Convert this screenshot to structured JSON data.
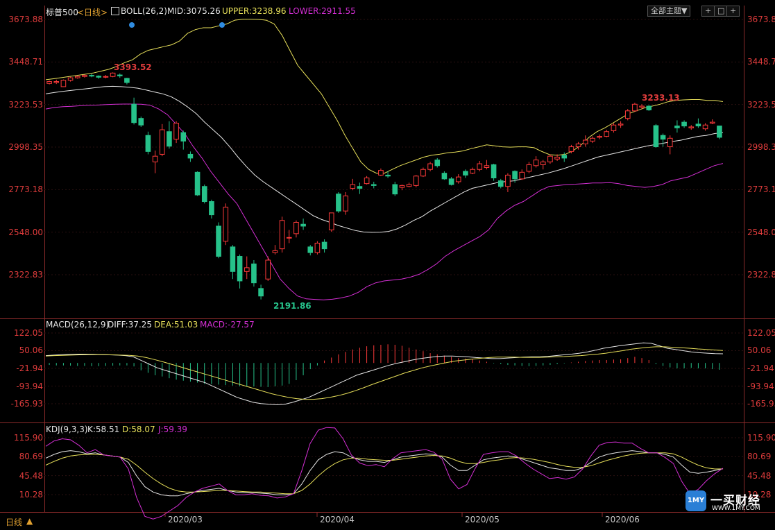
{
  "header": {
    "symbol": "标普500",
    "period_tag": "<日线>",
    "boll": {
      "label": "BOLL(26,2)",
      "mid": "MID:3075.26",
      "upper": "UPPER:3238.96",
      "lower": "LOWER:2911.55"
    },
    "theme_button": "全部主题▼",
    "tool_icons": [
      "+",
      "□",
      "+"
    ]
  },
  "macd_header": {
    "label": "MACD(26,12,9)",
    "diff": "DIFF:37.25",
    "dea": "DEA:51.03",
    "macd": "MACD:-27.57"
  },
  "kdj_header": {
    "label": "KDJ(9,3,3)",
    "k": "K:58.51",
    "d": "D:58.07",
    "j": "J:59.39"
  },
  "price_axis": [
    "3673.88",
    "3448.71",
    "3223.53",
    "2998.35",
    "2773.18",
    "2548.00",
    "2322.83"
  ],
  "macd_axis": [
    "122.05",
    "50.06",
    "-21.94",
    "-93.94",
    "-165.93"
  ],
  "kdj_axis": [
    "115.90",
    "80.69",
    "45.48",
    "10.28"
  ],
  "x_axis": [
    "2020/03",
    "2020/04",
    "2020/05",
    "2020/06"
  ],
  "annotations": {
    "high_left": "3393.52",
    "low": "2191.86",
    "high_right": "3233.13"
  },
  "footer": {
    "period": "日线",
    "arrow": "▲"
  },
  "watermark": {
    "brand": "一买财经",
    "url": "WWW.1MY.COM",
    "logo_text": "1MY"
  },
  "colors": {
    "up": "#ff3b3b",
    "down": "#26c28a",
    "upper": "#e8e05a",
    "mid": "#e6e6e6",
    "lower": "#d52fd5",
    "label_red": "#e03c3c"
  },
  "chart_data": {
    "type": "candlestick",
    "candles": [
      {
        "o": 3335,
        "c": 3345,
        "h": 3350,
        "l": 3330
      },
      {
        "o": 3340,
        "c": 3345,
        "h": 3355,
        "l": 3332
      },
      {
        "o": 3318,
        "c": 3352,
        "h": 3356,
        "l": 3316
      },
      {
        "o": 3352,
        "c": 3365,
        "h": 3370,
        "l": 3345
      },
      {
        "o": 3365,
        "c": 3372,
        "h": 3376,
        "l": 3360
      },
      {
        "o": 3372,
        "c": 3378,
        "h": 3382,
        "l": 3366
      },
      {
        "o": 3378,
        "c": 3374,
        "h": 3385,
        "l": 3368
      },
      {
        "o": 3374,
        "c": 3368,
        "h": 3378,
        "l": 3360
      },
      {
        "o": 3368,
        "c": 3372,
        "h": 3380,
        "l": 3362
      },
      {
        "o": 3372,
        "c": 3390,
        "h": 3393.52,
        "l": 3368
      },
      {
        "o": 3380,
        "c": 3375,
        "h": 3388,
        "l": 3365
      },
      {
        "o": 3362,
        "c": 3340,
        "h": 3365,
        "l": 3330
      },
      {
        "o": 3225,
        "c": 3128,
        "h": 3260,
        "l": 3118
      },
      {
        "o": 3150,
        "c": 3115,
        "h": 3160,
        "l": 3105
      },
      {
        "o": 3060,
        "c": 2975,
        "h": 3080,
        "l": 2960
      },
      {
        "o": 2920,
        "c": 2950,
        "h": 2980,
        "l": 2860
      },
      {
        "o": 2960,
        "c": 3090,
        "h": 3120,
        "l": 2950
      },
      {
        "o": 3080,
        "c": 3003,
        "h": 3135,
        "l": 2990
      },
      {
        "o": 3040,
        "c": 3125,
        "h": 3135,
        "l": 3020
      },
      {
        "o": 3075,
        "c": 3030,
        "h": 3085,
        "l": 2985
      },
      {
        "o": 2960,
        "c": 2940,
        "h": 2975,
        "l": 2920
      },
      {
        "o": 2865,
        "c": 2745,
        "h": 2870,
        "l": 2740
      },
      {
        "o": 2790,
        "c": 2710,
        "h": 2800,
        "l": 2700
      },
      {
        "o": 2710,
        "c": 2640,
        "h": 2720,
        "l": 2620
      },
      {
        "o": 2580,
        "c": 2420,
        "h": 2600,
        "l": 2410
      },
      {
        "o": 2500,
        "c": 2680,
        "h": 2700,
        "l": 2480
      },
      {
        "o": 2470,
        "c": 2340,
        "h": 2480,
        "l": 2300
      },
      {
        "o": 2420,
        "c": 2290,
        "h": 2430,
        "l": 2250
      },
      {
        "o": 2340,
        "c": 2360,
        "h": 2420,
        "l": 2300
      },
      {
        "o": 2380,
        "c": 2280,
        "h": 2400,
        "l": 2260
      },
      {
        "o": 2250,
        "c": 2210,
        "h": 2270,
        "l": 2191.86
      },
      {
        "o": 2300,
        "c": 2400,
        "h": 2420,
        "l": 2290
      },
      {
        "o": 2440,
        "c": 2450,
        "h": 2480,
        "l": 2430
      },
      {
        "o": 2460,
        "c": 2610,
        "h": 2630,
        "l": 2440
      },
      {
        "o": 2520,
        "c": 2520,
        "h": 2560,
        "l": 2490
      },
      {
        "o": 2540,
        "c": 2600,
        "h": 2610,
        "l": 2520
      },
      {
        "o": 2590,
        "c": 2580,
        "h": 2620,
        "l": 2560
      },
      {
        "o": 2470,
        "c": 2440,
        "h": 2480,
        "l": 2425
      },
      {
        "o": 2440,
        "c": 2490,
        "h": 2500,
        "l": 2430
      },
      {
        "o": 2495,
        "c": 2460,
        "h": 2510,
        "l": 2440
      },
      {
        "o": 2560,
        "c": 2650,
        "h": 2650,
        "l": 2550
      },
      {
        "o": 2750,
        "c": 2660,
        "h": 2760,
        "l": 2650
      },
      {
        "o": 2660,
        "c": 2740,
        "h": 2760,
        "l": 2640
      },
      {
        "o": 2780,
        "c": 2800,
        "h": 2830,
        "l": 2770
      },
      {
        "o": 2790,
        "c": 2780,
        "h": 2810,
        "l": 2750
      },
      {
        "o": 2805,
        "c": 2835,
        "h": 2845,
        "l": 2800
      },
      {
        "o": 2800,
        "c": 2795,
        "h": 2815,
        "l": 2780
      },
      {
        "o": 2850,
        "c": 2875,
        "h": 2885,
        "l": 2845
      },
      {
        "o": 2850,
        "c": 2845,
        "h": 2870,
        "l": 2835
      },
      {
        "o": 2800,
        "c": 2750,
        "h": 2815,
        "l": 2740
      },
      {
        "o": 2785,
        "c": 2795,
        "h": 2800,
        "l": 2770
      },
      {
        "o": 2790,
        "c": 2800,
        "h": 2810,
        "l": 2785
      },
      {
        "o": 2795,
        "c": 2845,
        "h": 2850,
        "l": 2785
      },
      {
        "o": 2845,
        "c": 2880,
        "h": 2890,
        "l": 2840
      },
      {
        "o": 2880,
        "c": 2910,
        "h": 2920,
        "l": 2870
      },
      {
        "o": 2930,
        "c": 2900,
        "h": 2940,
        "l": 2890
      },
      {
        "o": 2860,
        "c": 2830,
        "h": 2870,
        "l": 2825
      },
      {
        "o": 2830,
        "c": 2800,
        "h": 2840,
        "l": 2795
      },
      {
        "o": 2815,
        "c": 2840,
        "h": 2855,
        "l": 2805
      },
      {
        "o": 2870,
        "c": 2850,
        "h": 2880,
        "l": 2835
      },
      {
        "o": 2860,
        "c": 2880,
        "h": 2890,
        "l": 2855
      },
      {
        "o": 2880,
        "c": 2910,
        "h": 2925,
        "l": 2870
      },
      {
        "o": 2890,
        "c": 2900,
        "h": 2930,
        "l": 2880
      },
      {
        "o": 2905,
        "c": 2835,
        "h": 2910,
        "l": 2820
      },
      {
        "o": 2820,
        "c": 2790,
        "h": 2830,
        "l": 2780
      },
      {
        "o": 2790,
        "c": 2850,
        "h": 2860,
        "l": 2760
      },
      {
        "o": 2870,
        "c": 2830,
        "h": 2875,
        "l": 2810
      },
      {
        "o": 2830,
        "c": 2865,
        "h": 2880,
        "l": 2825
      },
      {
        "o": 2870,
        "c": 2905,
        "h": 2920,
        "l": 2860
      },
      {
        "o": 2900,
        "c": 2930,
        "h": 2950,
        "l": 2890
      },
      {
        "o": 2905,
        "c": 2920,
        "h": 2930,
        "l": 2880
      },
      {
        "o": 2920,
        "c": 2950,
        "h": 2960,
        "l": 2910
      },
      {
        "o": 2935,
        "c": 2945,
        "h": 2960,
        "l": 2925
      },
      {
        "o": 2955,
        "c": 2940,
        "h": 2970,
        "l": 2920
      },
      {
        "o": 2975,
        "c": 3000,
        "h": 3010,
        "l": 2965
      },
      {
        "o": 3000,
        "c": 3015,
        "h": 3025,
        "l": 2985
      },
      {
        "o": 3015,
        "c": 3035,
        "h": 3060,
        "l": 3000
      },
      {
        "o": 3030,
        "c": 3045,
        "h": 3055,
        "l": 3020
      },
      {
        "o": 3050,
        "c": 3055,
        "h": 3065,
        "l": 3040
      },
      {
        "o": 3055,
        "c": 3080,
        "h": 3090,
        "l": 3050
      },
      {
        "o": 3085,
        "c": 3115,
        "h": 3125,
        "l": 3075
      },
      {
        "o": 3115,
        "c": 3120,
        "h": 3135,
        "l": 3100
      },
      {
        "o": 3150,
        "c": 3190,
        "h": 3200,
        "l": 3140
      },
      {
        "o": 3190,
        "c": 3225,
        "h": 3233.13,
        "l": 3185
      },
      {
        "o": 3210,
        "c": 3215,
        "h": 3225,
        "l": 3200
      },
      {
        "o": 3215,
        "c": 3195,
        "h": 3220,
        "l": 3190
      },
      {
        "o": 3112,
        "c": 3000,
        "h": 3120,
        "l": 2995
      },
      {
        "o": 3060,
        "c": 3040,
        "h": 3070,
        "l": 3000
      },
      {
        "o": 3000,
        "c": 3045,
        "h": 3060,
        "l": 2960
      },
      {
        "o": 3110,
        "c": 3100,
        "h": 3140,
        "l": 3075
      },
      {
        "o": 3130,
        "c": 3110,
        "h": 3140,
        "l": 3100
      },
      {
        "o": 3100,
        "c": 3105,
        "h": 3115,
        "l": 3090
      },
      {
        "o": 3120,
        "c": 3110,
        "h": 3150,
        "l": 3100
      },
      {
        "o": 3095,
        "c": 3115,
        "h": 3125,
        "l": 3085
      },
      {
        "o": 3125,
        "c": 3130,
        "h": 3145,
        "l": 3120
      },
      {
        "o": 3110,
        "c": 3050,
        "h": 3110,
        "l": 3040
      }
    ],
    "boll_upper": [
      3355,
      3360,
      3366,
      3372,
      3378,
      3384,
      3390,
      3400,
      3410,
      3425,
      3445,
      3460,
      3490,
      3510,
      3520,
      3530,
      3540,
      3560,
      3600,
      3620,
      3630,
      3630,
      3640,
      3650,
      3670,
      3675,
      3675,
      3673.88,
      3670,
      3650,
      3590,
      3510,
      3430,
      3380,
      3330,
      3280,
      3210,
      3140,
      3060,
      2990,
      2920,
      2880,
      2860,
      2860,
      2880,
      2900,
      2915,
      2930,
      2945,
      2955,
      2960,
      2968,
      2972,
      2978,
      2990,
      3000,
      3010,
      3005,
      3000,
      2998,
      3000,
      3000,
      2995,
      2975,
      2958,
      2955,
      2960,
      2980,
      3010,
      3050,
      3080,
      3100,
      3125,
      3150,
      3175,
      3190,
      3205,
      3215,
      3225,
      3238,
      3245,
      3248,
      3250,
      3250,
      3245,
      3245,
      3238.96
    ],
    "boll_mid": [
      3280,
      3287,
      3293,
      3298,
      3303,
      3308,
      3313,
      3318,
      3320,
      3318,
      3315,
      3310,
      3300,
      3290,
      3280,
      3265,
      3240,
      3210,
      3175,
      3130,
      3090,
      3050,
      3000,
      2945,
      2895,
      2850,
      2815,
      2785,
      2755,
      2725,
      2695,
      2665,
      2635,
      2615,
      2600,
      2583,
      2570,
      2557,
      2549,
      2547,
      2548,
      2552,
      2565,
      2585,
      2610,
      2630,
      2660,
      2685,
      2710,
      2735,
      2760,
      2780,
      2790,
      2800,
      2810,
      2816,
      2820,
      2830,
      2840,
      2850,
      2860,
      2872,
      2885,
      2900,
      2915,
      2930,
      2945,
      2955,
      2965,
      2975,
      2985,
      2995,
      3005,
      3012,
      3020,
      3028,
      3035,
      3045,
      3055,
      3060,
      3070,
      3075.26
    ],
    "boll_lower": [
      3200,
      3208,
      3212,
      3214,
      3217,
      3220,
      3221,
      3223,
      3225,
      3226,
      3226,
      3225,
      3220,
      3200,
      3170,
      3120,
      3070,
      3000,
      2940,
      2870,
      2810,
      2750,
      2700,
      2620,
      2540,
      2460,
      2380,
      2300,
      2250,
      2210,
      2195,
      2192,
      2190,
      2193,
      2200,
      2210,
      2230,
      2260,
      2280,
      2290,
      2295,
      2300,
      2310,
      2325,
      2350,
      2380,
      2420,
      2450,
      2475,
      2500,
      2525,
      2560,
      2620,
      2660,
      2690,
      2710,
      2740,
      2770,
      2790,
      2795,
      2800,
      2802,
      2805,
      2808,
      2808,
      2810,
      2805,
      2795,
      2790,
      2785,
      2790,
      2800,
      2820,
      2830,
      2840,
      2860,
      2880,
      2900,
      2911.55
    ],
    "macd_hist": [
      -8,
      -10,
      -10,
      -11,
      -12,
      -12,
      -13,
      -13,
      -12,
      -11,
      -10,
      -10,
      -14,
      -30,
      -40,
      -50,
      -55,
      -62,
      -68,
      -72,
      -76,
      -80,
      -85,
      -86,
      -88,
      -90,
      -92,
      -95,
      -96,
      -96,
      -97,
      -98,
      -95,
      -92,
      -85,
      -70,
      -50,
      -25,
      -10,
      10,
      22,
      35,
      45,
      55,
      62,
      68,
      72,
      74,
      76,
      74,
      70,
      62,
      55,
      48,
      40,
      35,
      30,
      25,
      20,
      18,
      15,
      10,
      5,
      -2,
      -5,
      -8,
      -10,
      -12,
      -13,
      -12,
      -10,
      -8,
      -5,
      -2,
      2,
      5,
      8,
      10,
      12,
      12,
      14,
      15,
      20,
      25,
      20,
      12,
      -5,
      -12,
      -18,
      -22,
      -22,
      -20,
      -22,
      -22,
      -25,
      -27.57
    ],
    "macd_diff": [
      30,
      32,
      34,
      35,
      36,
      36,
      35,
      34,
      33,
      32,
      30,
      25,
      10,
      -5,
      -20,
      -30,
      -40,
      -50,
      -60,
      -70,
      -80,
      -95,
      -110,
      -125,
      -140,
      -150,
      -160,
      -165,
      -168,
      -170,
      -168,
      -160,
      -150,
      -140,
      -125,
      -110,
      -95,
      -80,
      -65,
      -50,
      -40,
      -30,
      -20,
      -10,
      -2,
      5,
      12,
      18,
      22,
      26,
      28,
      28,
      27,
      25,
      22,
      20,
      18,
      18,
      20,
      22,
      24,
      25,
      25,
      27,
      30,
      33,
      36,
      40,
      45,
      52,
      60,
      65,
      70,
      74,
      78,
      82,
      80,
      70,
      60,
      55,
      50,
      45,
      42,
      40,
      38,
      37.25
    ],
    "macd_dea": [
      28,
      30,
      31,
      32,
      33,
      34,
      34,
      34,
      33,
      32,
      31,
      28,
      22,
      14,
      5,
      -5,
      -15,
      -25,
      -35,
      -45,
      -55,
      -65,
      -75,
      -85,
      -95,
      -105,
      -115,
      -125,
      -133,
      -140,
      -145,
      -148,
      -148,
      -145,
      -140,
      -133,
      -124,
      -113,
      -101,
      -88,
      -76,
      -64,
      -52,
      -40,
      -30,
      -20,
      -12,
      -5,
      2,
      8,
      12,
      16,
      19,
      22,
      24,
      24,
      24,
      23,
      23,
      23,
      24,
      25,
      26,
      28,
      30,
      33,
      36,
      40,
      45,
      50,
      56,
      60,
      64,
      66,
      66,
      64,
      62,
      60,
      57,
      55,
      53,
      51.03
    ],
    "kdj_k": [
      78,
      85,
      90,
      92,
      90,
      86,
      88,
      84,
      82,
      80,
      70,
      45,
      25,
      15,
      10,
      8,
      8,
      12,
      15,
      18,
      20,
      22,
      18,
      15,
      14,
      14,
      13,
      12,
      10,
      10,
      12,
      30,
      55,
      75,
      85,
      90,
      88,
      80,
      75,
      72,
      72,
      70,
      75,
      80,
      82,
      84,
      86,
      85,
      80,
      65,
      55,
      55,
      65,
      75,
      78,
      80,
      82,
      80,
      75,
      70,
      65,
      60,
      58,
      55,
      55,
      60,
      70,
      80,
      85,
      88,
      90,
      92,
      90,
      88,
      88,
      85,
      80,
      65,
      52,
      50,
      52,
      55,
      58.51
    ],
    "kdj_d": [
      65,
      72,
      78,
      82,
      84,
      85,
      85,
      84,
      82,
      80,
      76,
      65,
      52,
      40,
      30,
      22,
      17,
      15,
      15,
      16,
      17,
      18,
      18,
      17,
      16,
      15,
      15,
      14,
      13,
      12,
      12,
      18,
      30,
      45,
      58,
      68,
      75,
      78,
      78,
      76,
      75,
      74,
      74,
      76,
      78,
      80,
      82,
      83,
      82,
      78,
      72,
      68,
      68,
      70,
      73,
      75,
      78,
      79,
      78,
      76,
      73,
      70,
      66,
      63,
      61,
      61,
      64,
      69,
      74,
      78,
      82,
      85,
      87,
      88,
      88,
      88,
      86,
      80,
      72,
      65,
      60,
      58,
      58.07
    ],
    "kdj_j": [
      100,
      110,
      114,
      112,
      102,
      88,
      94,
      84,
      82,
      80,
      58,
      5,
      -30,
      -35,
      -30,
      -20,
      -10,
      5,
      15,
      22,
      26,
      30,
      18,
      10,
      10,
      12,
      9,
      8,
      4,
      6,
      12,
      55,
      105,
      130,
      135,
      134,
      114,
      84,
      69,
      64,
      66,
      62,
      77,
      88,
      90,
      92,
      94,
      89,
      76,
      39,
      21,
      29,
      59,
      85,
      88,
      90,
      90,
      82,
      69,
      58,
      49,
      40,
      42,
      39,
      43,
      58,
      82,
      102,
      107,
      108,
      106,
      106,
      96,
      88,
      88,
      79,
      68,
      35,
      12,
      20,
      36,
      49,
      59.39
    ]
  }
}
